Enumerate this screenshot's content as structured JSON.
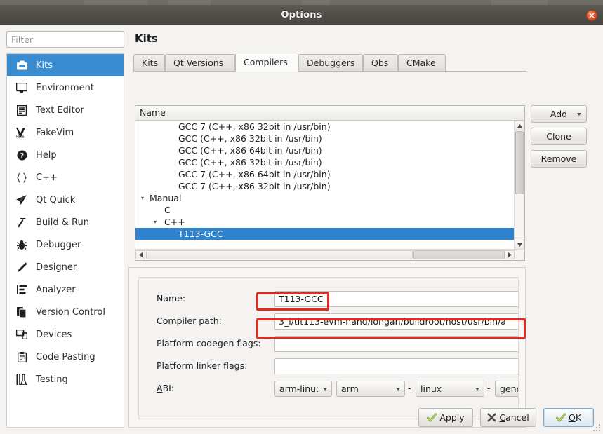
{
  "window": {
    "title": "Options",
    "close_label": "Close"
  },
  "sidebar": {
    "filter_placeholder": "Filter",
    "filter_value": "",
    "items": [
      {
        "label": "Kits",
        "icon": "kits-icon",
        "selected": true
      },
      {
        "label": "Environment",
        "icon": "monitor-icon",
        "selected": false
      },
      {
        "label": "Text Editor",
        "icon": "text-document-icon",
        "selected": false
      },
      {
        "label": "FakeVim",
        "icon": "fakevim-icon",
        "selected": false
      },
      {
        "label": "Help",
        "icon": "question-circle-icon",
        "selected": false
      },
      {
        "label": "C++",
        "icon": "braces-icon",
        "selected": false
      },
      {
        "label": "Qt Quick",
        "icon": "paper-plane-icon",
        "selected": false
      },
      {
        "label": "Build & Run",
        "icon": "hammer-icon",
        "selected": false
      },
      {
        "label": "Debugger",
        "icon": "bug-icon",
        "selected": false
      },
      {
        "label": "Designer",
        "icon": "pencil-icon",
        "selected": false
      },
      {
        "label": "Analyzer",
        "icon": "bars-chart-icon",
        "selected": false
      },
      {
        "label": "Version Control",
        "icon": "copy-files-icon",
        "selected": false
      },
      {
        "label": "Devices",
        "icon": "devices-icon",
        "selected": false
      },
      {
        "label": "Code Pasting",
        "icon": "clipboard-icon",
        "selected": false
      },
      {
        "label": "Testing",
        "icon": "test-tube-icon",
        "selected": false
      }
    ]
  },
  "pane": {
    "title": "Kits",
    "tabs": [
      {
        "label": "Kits",
        "active": false
      },
      {
        "label": "Qt Versions",
        "active": false
      },
      {
        "label": "Compilers",
        "active": true
      },
      {
        "label": "Debuggers",
        "active": false
      },
      {
        "label": "Qbs",
        "active": false
      },
      {
        "label": "CMake",
        "active": false
      }
    ]
  },
  "tree": {
    "header": "Name",
    "rows": [
      {
        "text": "GCC 7 (C++, x86 32bit in /usr/bin)",
        "indent": 3,
        "arrow": "",
        "selected": false
      },
      {
        "text": "GCC (C++, x86 32bit in /usr/bin)",
        "indent": 3,
        "arrow": "",
        "selected": false
      },
      {
        "text": "GCC (C++, x86 64bit in /usr/bin)",
        "indent": 3,
        "arrow": "",
        "selected": false
      },
      {
        "text": "GCC (C++, x86 32bit in /usr/bin)",
        "indent": 3,
        "arrow": "",
        "selected": false
      },
      {
        "text": "GCC 7 (C++, x86 64bit in /usr/bin)",
        "indent": 3,
        "arrow": "",
        "selected": false
      },
      {
        "text": "GCC 7 (C++, x86 32bit in /usr/bin)",
        "indent": 3,
        "arrow": "",
        "selected": false
      },
      {
        "text": "Manual",
        "indent": 1,
        "arrow": "▾",
        "selected": false
      },
      {
        "text": "C",
        "indent": 2,
        "arrow": "",
        "selected": false
      },
      {
        "text": "C++",
        "indent": 2,
        "arrow": "▾",
        "selected": false
      },
      {
        "text": "T113-GCC",
        "indent": 3,
        "arrow": "",
        "selected": true
      }
    ]
  },
  "side_buttons": {
    "add": "Add",
    "clone": "Clone",
    "remove": "Remove"
  },
  "form": {
    "name_label": "Name:",
    "name_value": "T113-GCC",
    "compiler_path_label": "Compiler path:",
    "compiler_path_value": "3_i/tlt113-evm-nand/longan/buildroot/host/usr/bin/a",
    "codegen_label": "Platform codegen flags:",
    "codegen_value": "",
    "linker_label": "Platform linker flags:",
    "linker_value": "",
    "abi_label": "ABI:",
    "abi": {
      "preset": "arm-linu:",
      "architecture": "arm",
      "os": "linux",
      "flavor": "generic",
      "separator": "-"
    }
  },
  "annotations": {
    "accent_color": "#e02b20",
    "highlighted_fields": [
      "name_value",
      "compiler_path_value"
    ]
  },
  "footer": {
    "apply": "Apply",
    "cancel": "Cancel",
    "ok": "OK"
  }
}
